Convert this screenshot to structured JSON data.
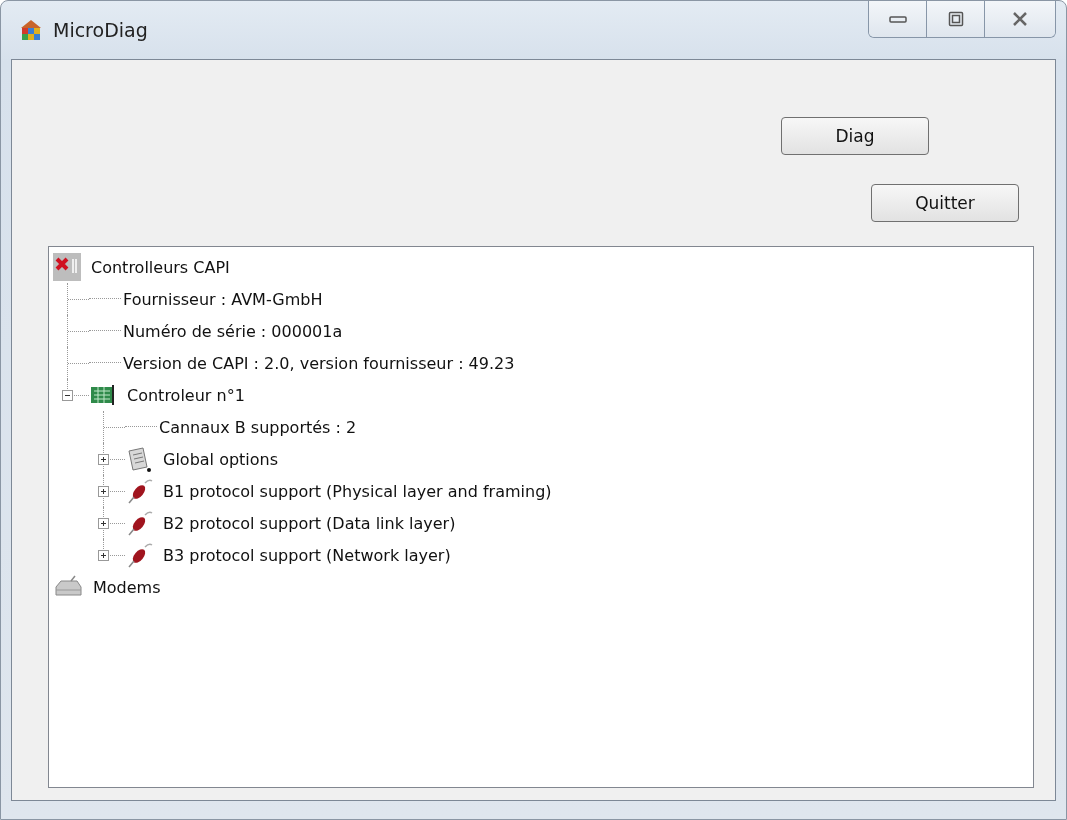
{
  "window": {
    "title": "MicroDiag",
    "controls": [
      {
        "kind": "minimize"
      },
      {
        "kind": "maximize"
      },
      {
        "kind": "close"
      }
    ]
  },
  "buttons": [
    {
      "label": "Diag"
    },
    {
      "label": "Quitter"
    }
  ],
  "tree": [
    {
      "label": "Controlleurs CAPI",
      "kind": "capi",
      "children": [
        {
          "label": "Fournisseur : AVM-GmbH"
        },
        {
          "label": "Numéro de série : 000001a"
        },
        {
          "label": "Version de CAPI : 2.0, version fournisseur : 49.23"
        },
        {
          "label": "Controleur n°1",
          "kind": "board",
          "expanded": true,
          "children": [
            {
              "label": "Cannaux B supportés : 2"
            },
            {
              "label": "Global options",
              "kind": "options",
              "expanded": false
            },
            {
              "label": "B1 protocol support (Physical layer and framing)",
              "kind": "plug",
              "expanded": false
            },
            {
              "label": "B2 protocol support (Data link layer)",
              "kind": "plug",
              "expanded": false
            },
            {
              "label": "B3 protocol support (Network layer)",
              "kind": "plug",
              "expanded": false
            }
          ]
        }
      ]
    },
    {
      "label": "Modems",
      "kind": "modem"
    }
  ]
}
